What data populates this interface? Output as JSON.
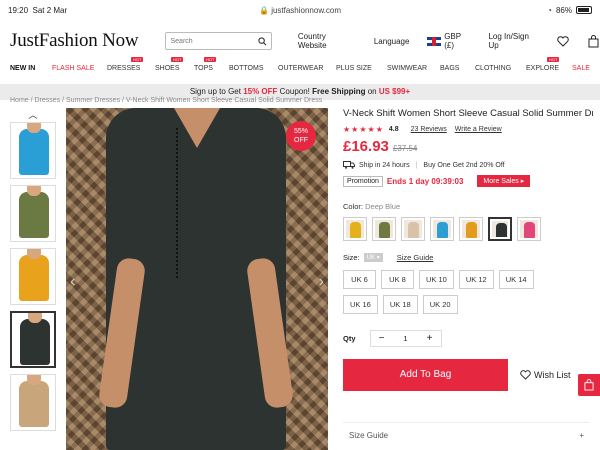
{
  "status_bar": {
    "time": "19:20",
    "date": "Sat 2 Mar",
    "url": "justfashionnow.com",
    "battery": "86%"
  },
  "header": {
    "logo": "JustFashion Now",
    "search_placeholder": "Search",
    "country": "Country Website",
    "language": "Language",
    "currency": "GBP (£)",
    "login": "Log In/Sign Up"
  },
  "nav": {
    "items": [
      {
        "label": "NEW IN"
      },
      {
        "label": "FLASH SALE"
      },
      {
        "label": "DRESSES",
        "hot": "HOT"
      },
      {
        "label": "SHOES",
        "hot": "HOT"
      },
      {
        "label": "TOPS",
        "hot": "HOT"
      },
      {
        "label": "BOTTOMS"
      },
      {
        "label": "OUTERWEAR"
      },
      {
        "label": "PLUS SIZE"
      },
      {
        "label": "SWIMWEAR"
      },
      {
        "label": "BAGS"
      },
      {
        "label": "CLOTHING"
      },
      {
        "label": "EXPLORE",
        "hot": "HOT"
      },
      {
        "label": "SALE"
      }
    ]
  },
  "promo": {
    "pre": "Sign up to Get ",
    "discount": "15% OFF",
    "mid": " Coupon! ",
    "free": "Free Shipping",
    "on": " on ",
    "threshold": "US $99+"
  },
  "breadcrumb": "Home / Dresses / Summer Dresses / V-Neck Shift Women Short Sleeve Casual Solid Summer Dress",
  "product": {
    "title": "V-Neck Shift Women Short Sleeve Casual Solid Summer Dress",
    "stars": "★★★★★",
    "rating": "4.8",
    "reviews": "23 Reviews",
    "write_review": "Write a Review",
    "price": "£16.93",
    "old_price": "£37.54",
    "discount_pct": "55%",
    "discount_off": "OFF",
    "ship": "Ship in 24 hours",
    "offer": "Buy One Get 2nd 20% Off",
    "promotion_label": "Promotion",
    "ends_in": "Ends 1 day 09:39:03",
    "more_sales": "More Sales",
    "color_label": "Color:",
    "color_value": "Deep Blue",
    "size_label": "Size:",
    "size_region": "UK",
    "size_guide": "Size Guide",
    "sizes": [
      "UK 6",
      "UK 8",
      "UK 10",
      "UK 12",
      "UK 14",
      "UK 16",
      "UK 18",
      "UK 20"
    ],
    "qty_label": "Qty",
    "qty": "1",
    "add_to_bag": "Add To Bag",
    "wish_list": "Wish List",
    "size_guide_row": "Size Guide",
    "swatch_colors": [
      "#e3b21a",
      "#6e7a3e",
      "#d9c3a8",
      "#2d9dd2",
      "#e39b1e",
      "#2c3331",
      "#e0467a"
    ],
    "thumb_colors": [
      "#2a9fd6",
      "#6b7a42",
      "#e8a21c",
      "#2c3331",
      "#c8a57a"
    ]
  },
  "colors": {
    "accent": "#e5283f"
  }
}
